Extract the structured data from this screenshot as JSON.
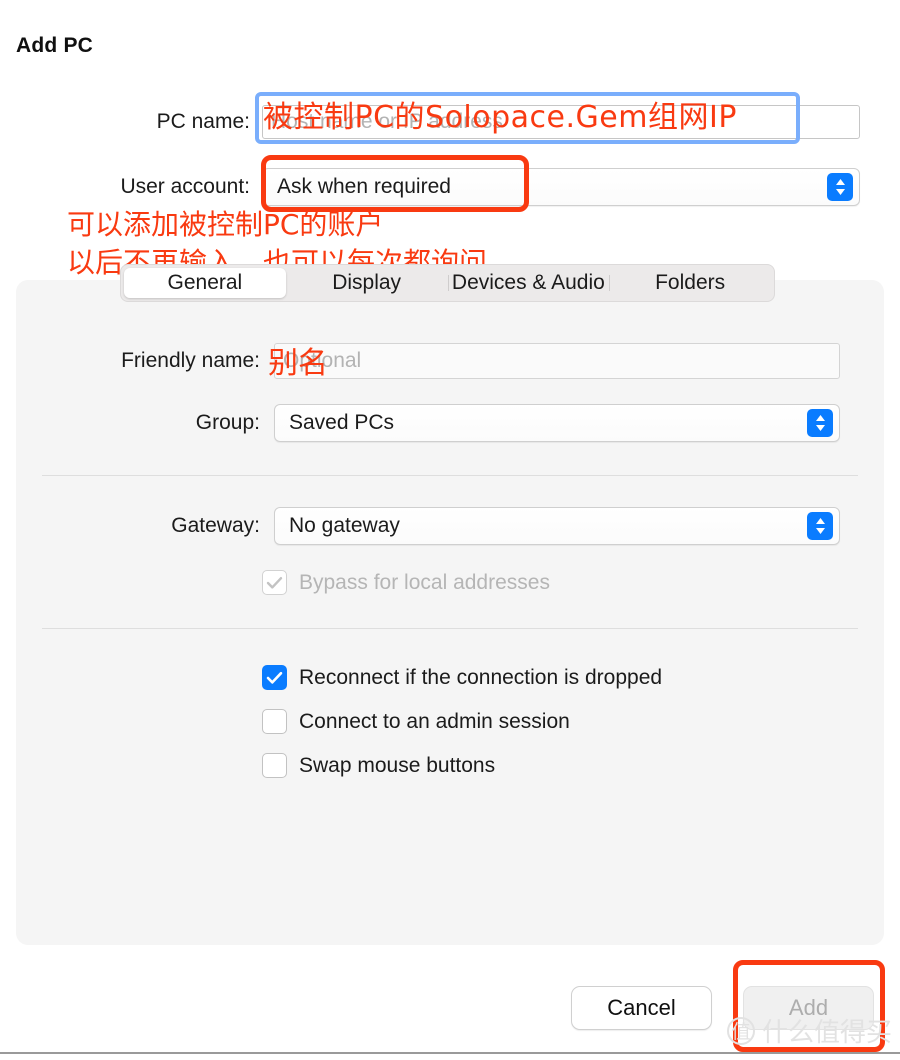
{
  "dialog": {
    "title": "Add PC"
  },
  "top_form": {
    "pc_name": {
      "label": "PC name:",
      "placeholder": "Host name or IP address",
      "value": ""
    },
    "user_account": {
      "label": "User account:",
      "value": "Ask when required"
    }
  },
  "tabs": [
    {
      "label": "General",
      "selected": true
    },
    {
      "label": "Display",
      "selected": false
    },
    {
      "label": "Devices & Audio",
      "selected": false
    },
    {
      "label": "Folders",
      "selected": false
    }
  ],
  "general_panel": {
    "friendly_name": {
      "label": "Friendly name:",
      "placeholder": "Optional",
      "value": ""
    },
    "group": {
      "label": "Group:",
      "value": "Saved PCs"
    },
    "gateway": {
      "label": "Gateway:",
      "value": "No gateway"
    },
    "bypass": {
      "label": "Bypass for local addresses",
      "checked": true,
      "disabled": true
    },
    "options": [
      {
        "label": "Reconnect if the connection is dropped",
        "checked": true
      },
      {
        "label": "Connect to an admin session",
        "checked": false
      },
      {
        "label": "Swap mouse buttons",
        "checked": false
      }
    ]
  },
  "footer": {
    "cancel_label": "Cancel",
    "add_label": "Add"
  },
  "annotations": {
    "pc_name_note": "被控制PC的Solopace.Gem组网IP",
    "account_note_line1": "可以添加被控制PC的账户",
    "account_note_line2": "以后不再输入，也可以每次都询问",
    "friendly_note": "别名",
    "color": "#f93a11"
  },
  "watermark": {
    "mark": "值",
    "text": "什么值得买"
  }
}
